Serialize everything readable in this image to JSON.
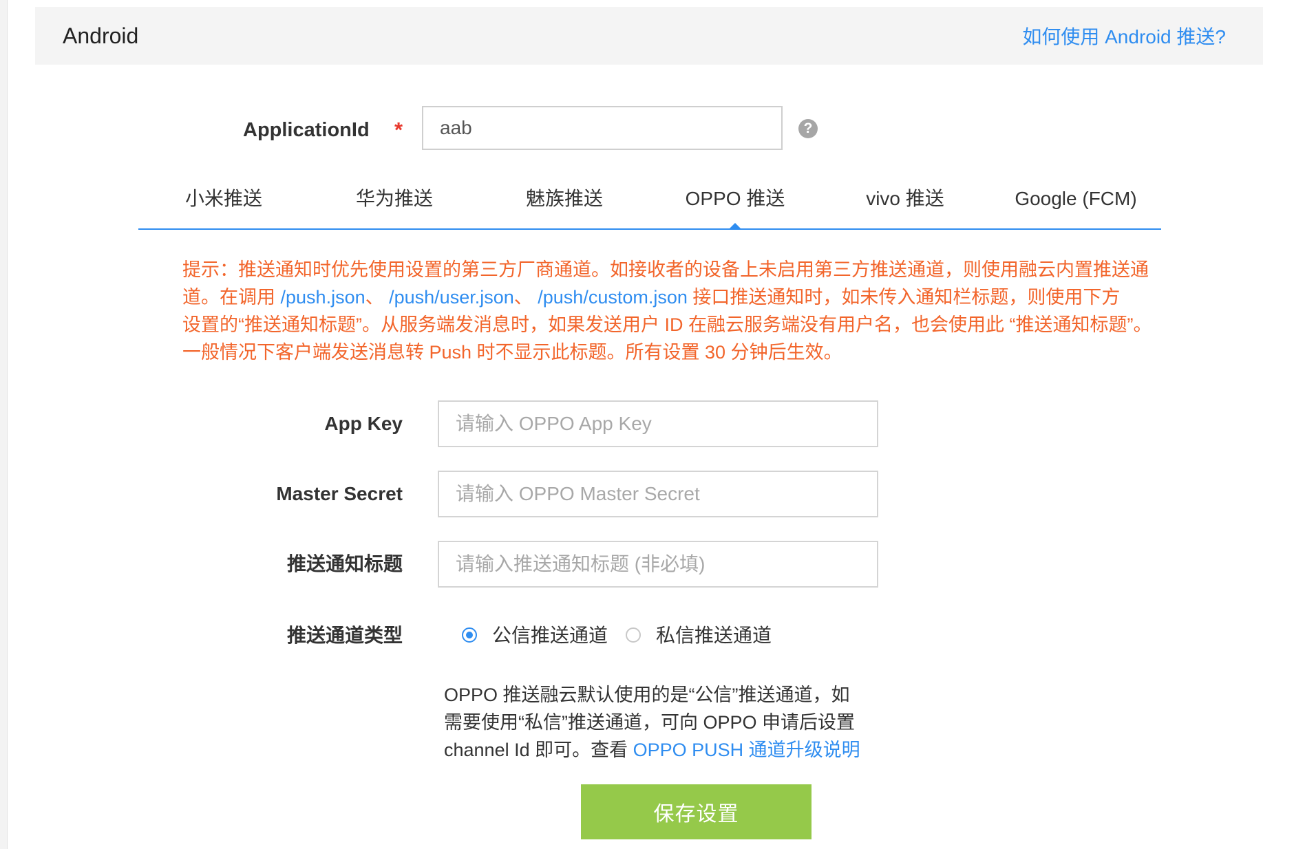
{
  "header": {
    "title": "Android",
    "help_link": "如何使用 Android 推送?"
  },
  "application_id": {
    "label": "ApplicationId",
    "required_mark": "*",
    "value": "aab",
    "help_icon": "?"
  },
  "tabs": [
    {
      "label": "小米推送",
      "active": false
    },
    {
      "label": "华为推送",
      "active": false
    },
    {
      "label": "魅族推送",
      "active": false
    },
    {
      "label": "OPPO 推送",
      "active": true
    },
    {
      "label": "vivo 推送",
      "active": false
    },
    {
      "label": "Google (FCM)",
      "active": false
    }
  ],
  "notice": {
    "line1": "提示：推送通知时优先使用设置的第三方厂商通道。如接收者的设备上未启用第三方推送通道，则使用融云内置推送通",
    "line2_prefix": "道。在调用 ",
    "link1": "/push.json",
    "sep1": "、 ",
    "link2": "/push/user.json",
    "sep2": "、 ",
    "link3": "/push/custom.json",
    "line2_suffix": " 接口推送通知时，如未传入通知栏标题，则使用下方",
    "line3": "设置的“推送通知标题”。从服务端发消息时，如果发送用户 ID 在融云服务端没有用户名，也会使用此 “推送通知标题”。",
    "line4": "一般情况下客户端发送消息转 Push 时不显示此标题。所有设置 30 分钟后生效。"
  },
  "form": {
    "app_key": {
      "label": "App Key",
      "placeholder": "请输入 OPPO App Key",
      "value": ""
    },
    "master_secret": {
      "label": "Master Secret",
      "placeholder": "请输入 OPPO Master Secret",
      "value": ""
    },
    "notification_title": {
      "label": "推送通知标题",
      "placeholder": "请输入推送通知标题 (非必填)",
      "value": ""
    },
    "channel_type": {
      "label": "推送通道类型",
      "options": [
        {
          "label": "公信推送通道",
          "checked": true
        },
        {
          "label": "私信推送通道",
          "checked": false
        }
      ]
    }
  },
  "channel_note": {
    "line1": "OPPO 推送融云默认使用的是“公信”推送通道，如",
    "line2": "需要使用“私信”推送通道，可向 OPPO 申请后设置",
    "line3_prefix": "channel Id 即可。查看 ",
    "link": "OPPO PUSH 通道升级说明"
  },
  "save_button": "保存设置",
  "colors": {
    "accent_blue": "#2f8df0",
    "notice_orange": "#f2652b",
    "save_green": "#95c94a",
    "required_red": "#e8392e"
  }
}
